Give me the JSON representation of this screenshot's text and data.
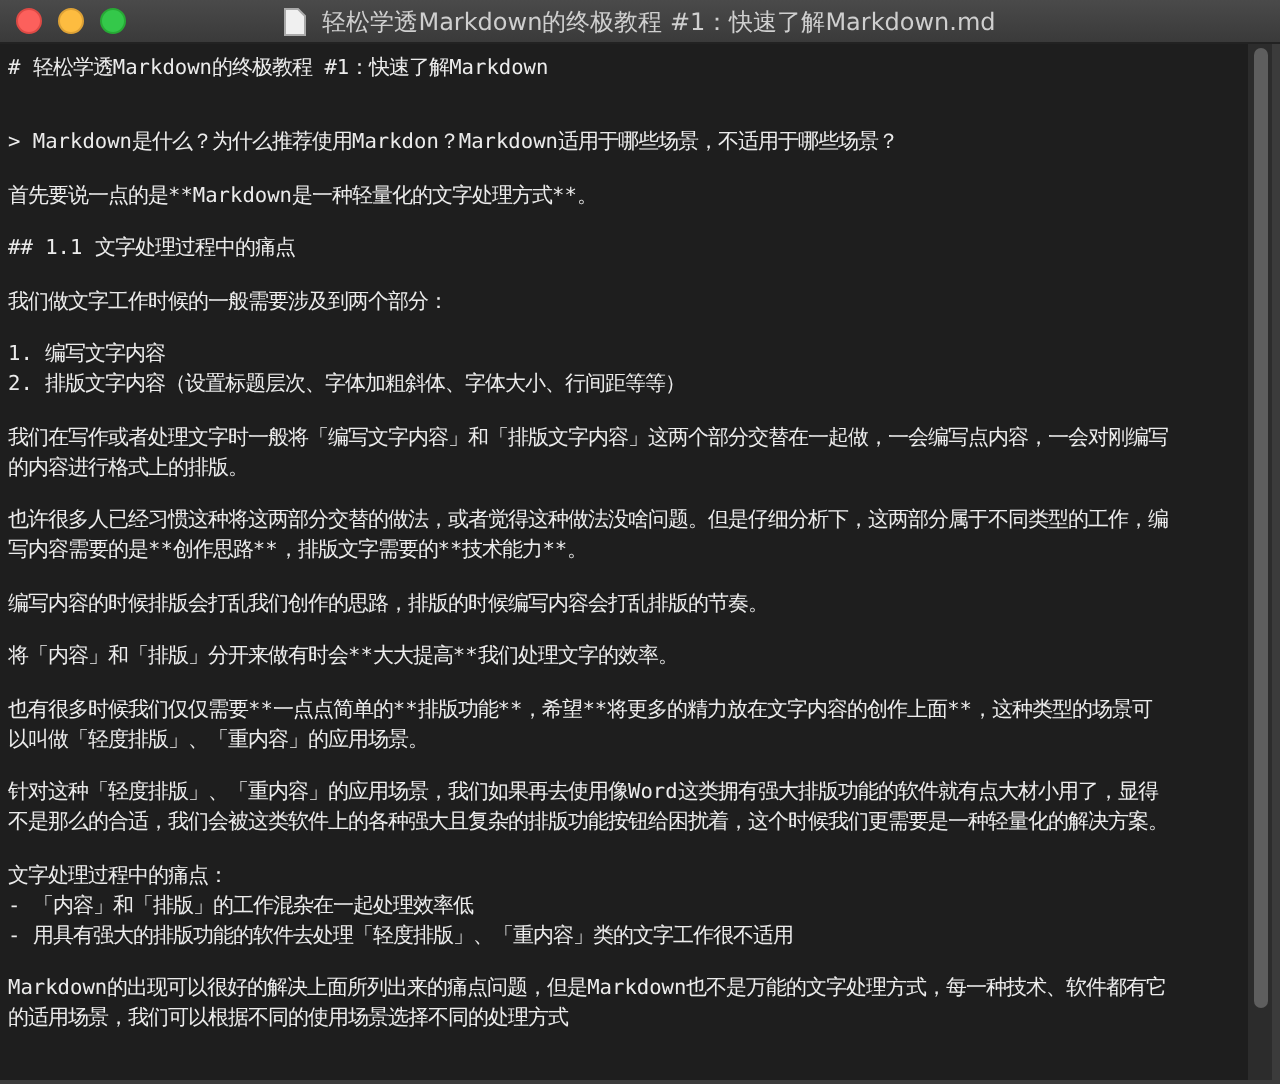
{
  "window": {
    "title": "轻松学透Markdown的终极教程 #1：快速了解Markdown.md"
  },
  "editor": {
    "blocks": [
      {
        "lines": [
          "# 轻松学透Markdown的终极教程 #1：快速了解Markdown"
        ]
      },
      {
        "lines": [
          "> Markdown是什么？为什么推荐使用Markdon？Markdown适用于哪些场景，不适用于哪些场景？"
        ]
      },
      {
        "lines": [
          "首先要说一点的是**Markdown是一种轻量化的文字处理方式**。"
        ]
      },
      {
        "lines": [
          "## 1.1 文字处理过程中的痛点"
        ]
      },
      {
        "lines": [
          "我们做文字工作时候的一般需要涉及到两个部分："
        ]
      },
      {
        "lines": [
          "1. 编写文字内容",
          "2. 排版文字内容（设置标题层次、字体加粗斜体、字体大小、行间距等等）"
        ]
      },
      {
        "lines": [
          "我们在写作或者处理文字时一般将「编写文字内容」和「排版文字内容」这两个部分交替在一起做，一会编写点内容，一会对刚编写",
          "的内容进行格式上的排版。"
        ]
      },
      {
        "lines": [
          "也许很多人已经习惯这种将这两部分交替的做法，或者觉得这种做法没啥问题。但是仔细分析下，这两部分属于不同类型的工作，编",
          "写内容需要的是**创作思路**，排版文字需要的**技术能力**。"
        ]
      },
      {
        "lines": [
          "编写内容的时候排版会打乱我们创作的思路，排版的时候编写内容会打乱排版的节奏。"
        ]
      },
      {
        "lines": [
          "将「内容」和「排版」分开来做有时会**大大提高**我们处理文字的效率。"
        ]
      },
      {
        "lines": [
          "也有很多时候我们仅仅需要**一点点简单的**排版功能**，希望**将更多的精力放在文字内容的创作上面**，这种类型的场景可",
          "以叫做「轻度排版」、「重内容」的应用场景。"
        ]
      },
      {
        "lines": [
          "针对这种「轻度排版」、「重内容」的应用场景，我们如果再去使用像Word这类拥有强大排版功能的软件就有点大材小用了，显得",
          "不是那么的合适，我们会被这类软件上的各种强大且复杂的排版功能按钮给困扰着，这个时候我们更需要是一种轻量化的解决方案。"
        ]
      },
      {
        "lines": [
          "文字处理过程中的痛点：",
          "- 「内容」和「排版」的工作混杂在一起处理效率低",
          "-  用具有强大的排版功能的软件去处理「轻度排版」、「重内容」类的文字工作很不适用"
        ]
      },
      {
        "lines": [
          "Markdown的出现可以很好的解决上面所列出来的痛点问题，但是Markdown也不是万能的文字处理方式，每一种技术、软件都有它",
          "的适用场景，我们可以根据不同的使用场景选择不同的处理方式"
        ]
      }
    ]
  }
}
